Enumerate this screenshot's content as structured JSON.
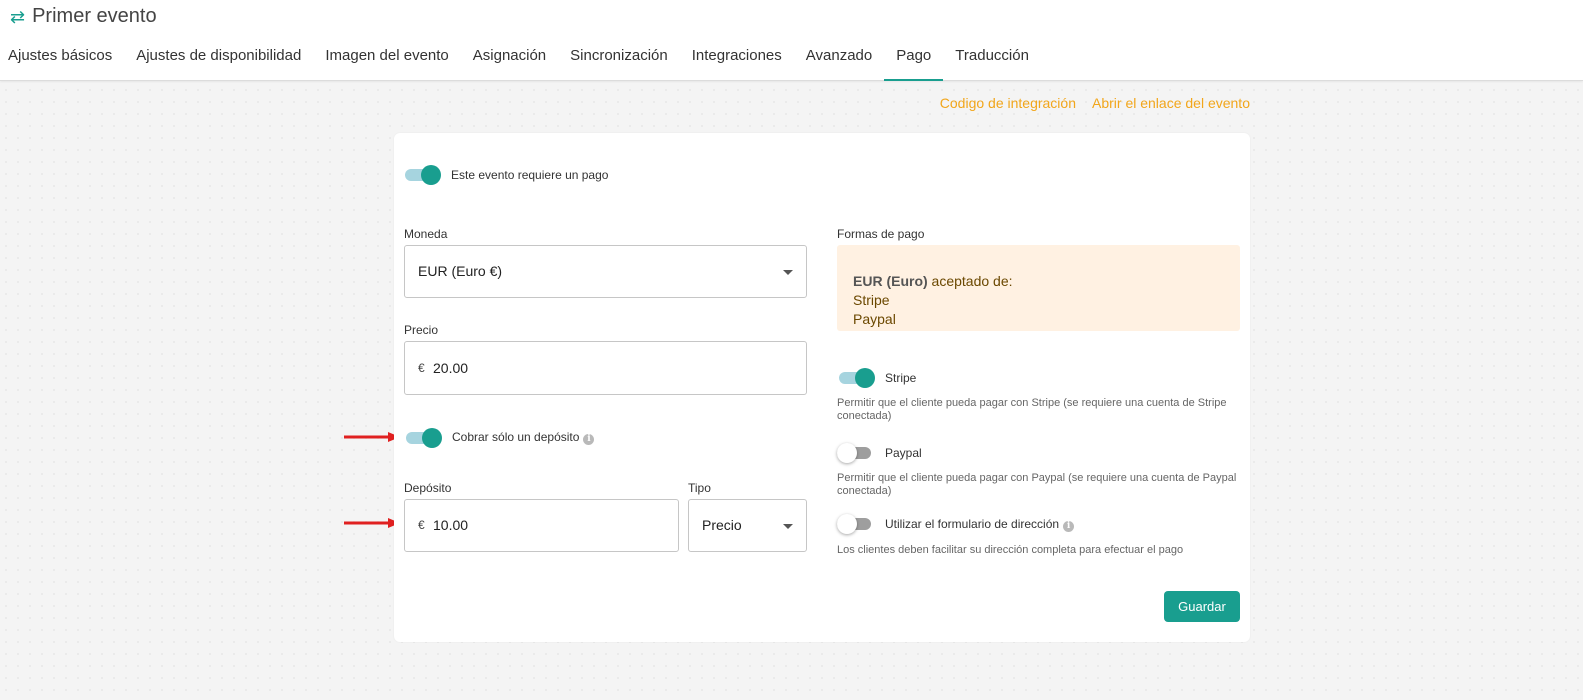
{
  "header": {
    "icon": "swap-arrows-icon",
    "title": "Primer evento"
  },
  "tabs": [
    {
      "label": "Ajustes básicos",
      "active": false
    },
    {
      "label": "Ajustes de disponibilidad",
      "active": false
    },
    {
      "label": "Imagen del evento",
      "active": false
    },
    {
      "label": "Asignación",
      "active": false
    },
    {
      "label": "Sincronización",
      "active": false
    },
    {
      "label": "Integraciones",
      "active": false
    },
    {
      "label": "Avanzado",
      "active": false
    },
    {
      "label": "Pago",
      "active": true
    },
    {
      "label": "Traducción",
      "active": false
    }
  ],
  "links": {
    "embed_code": "Codigo de integración",
    "open_link": "Abrir el enlace del evento"
  },
  "form": {
    "requires_payment": {
      "label": "Este evento requiere un pago",
      "on": true
    },
    "currency": {
      "label": "Moneda",
      "value": "EUR (Euro €)"
    },
    "price": {
      "label": "Precio",
      "prefix": "€",
      "value": "20.00"
    },
    "deposit_only": {
      "label": "Cobrar sólo un depósito",
      "on": true
    },
    "deposit": {
      "label": "Depósito",
      "prefix": "€",
      "value": "10.00"
    },
    "type": {
      "label": "Tipo",
      "value": "Precio"
    }
  },
  "payment_methods": {
    "label": "Formas de pago",
    "box": {
      "currency": "EUR (Euro)",
      "accepted": " aceptado de:",
      "providers": [
        "Stripe",
        "Paypal"
      ]
    },
    "stripe": {
      "label": "Stripe",
      "on": true,
      "help": "Permitir que el cliente pueda pagar con Stripe (se requiere una cuenta de Stripe conectada)"
    },
    "paypal": {
      "label": "Paypal",
      "on": false,
      "help": "Permitir que el cliente pueda pagar con Paypal (se requiere una cuenta de Paypal conectada)"
    },
    "address_form": {
      "label": "Utilizar el formulario de dirección",
      "on": false,
      "help": "Los clientes deben facilitar su dirección completa para efectuar el pago"
    }
  },
  "save_label": "Guardar",
  "colors": {
    "accent": "#199e8f",
    "link": "#f2a61b",
    "annotation_arrow": "#e02020",
    "paybox_bg": "#fff1e2"
  }
}
